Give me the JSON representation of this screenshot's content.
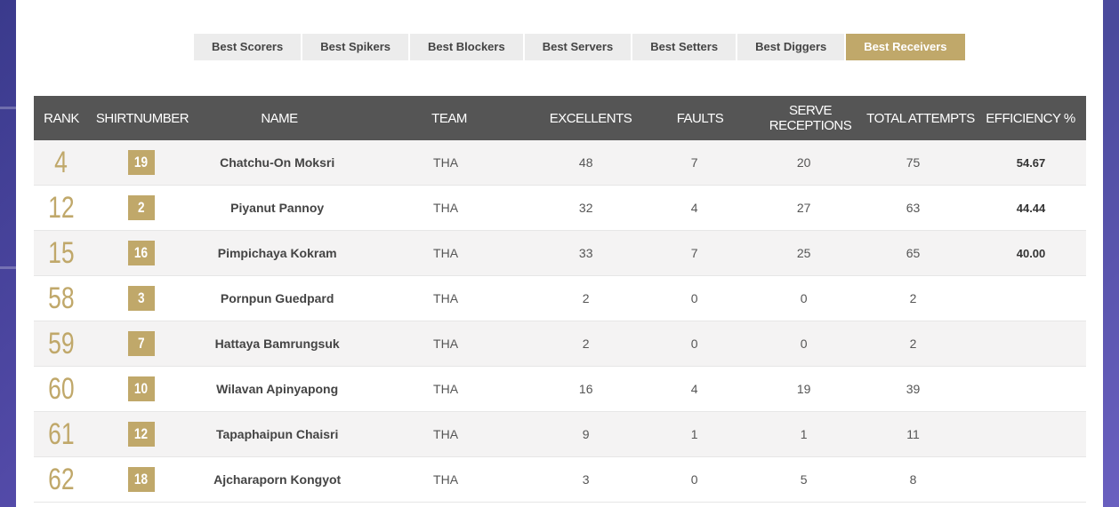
{
  "tabs": [
    {
      "label": "Best Scorers",
      "active": false
    },
    {
      "label": "Best Spikers",
      "active": false
    },
    {
      "label": "Best Blockers",
      "active": false
    },
    {
      "label": "Best Servers",
      "active": false
    },
    {
      "label": "Best Setters",
      "active": false
    },
    {
      "label": "Best Diggers",
      "active": false
    },
    {
      "label": "Best Receivers",
      "active": true
    }
  ],
  "table": {
    "headers": {
      "rank": "RANK",
      "shirt": "SHIRTNUMBER",
      "name": "NAME",
      "team": "TEAM",
      "excellents": "EXCELLENTS",
      "faults": "FAULTS",
      "serve_receptions": "SERVE RECEPTIONS",
      "total_attempts": "TOTAL ATTEMPTS",
      "efficiency": "EFFICIENCY %"
    },
    "rows": [
      {
        "rank": "4",
        "shirt": "19",
        "name": "Chatchu-On Moksri",
        "team": "THA",
        "excellents": "48",
        "faults": "7",
        "serve_receptions": "20",
        "total_attempts": "75",
        "efficiency": "54.67"
      },
      {
        "rank": "12",
        "shirt": "2",
        "name": "Piyanut Pannoy",
        "team": "THA",
        "excellents": "32",
        "faults": "4",
        "serve_receptions": "27",
        "total_attempts": "63",
        "efficiency": "44.44"
      },
      {
        "rank": "15",
        "shirt": "16",
        "name": "Pimpichaya Kokram",
        "team": "THA",
        "excellents": "33",
        "faults": "7",
        "serve_receptions": "25",
        "total_attempts": "65",
        "efficiency": "40.00"
      },
      {
        "rank": "58",
        "shirt": "3",
        "name": "Pornpun Guedpard",
        "team": "THA",
        "excellents": "2",
        "faults": "0",
        "serve_receptions": "0",
        "total_attempts": "2",
        "efficiency": ""
      },
      {
        "rank": "59",
        "shirt": "7",
        "name": "Hattaya Bamrungsuk",
        "team": "THA",
        "excellents": "2",
        "faults": "0",
        "serve_receptions": "0",
        "total_attempts": "2",
        "efficiency": ""
      },
      {
        "rank": "60",
        "shirt": "10",
        "name": "Wilavan Apinyapong",
        "team": "THA",
        "excellents": "16",
        "faults": "4",
        "serve_receptions": "19",
        "total_attempts": "39",
        "efficiency": ""
      },
      {
        "rank": "61",
        "shirt": "12",
        "name": "Tapaphaipun Chaisri",
        "team": "THA",
        "excellents": "9",
        "faults": "1",
        "serve_receptions": "1",
        "total_attempts": "11",
        "efficiency": ""
      },
      {
        "rank": "62",
        "shirt": "18",
        "name": "Ajcharaporn Kongyot",
        "team": "THA",
        "excellents": "3",
        "faults": "0",
        "serve_receptions": "5",
        "total_attempts": "8",
        "efficiency": ""
      }
    ]
  },
  "colors": {
    "accent": "#c0a86a",
    "header_bg": "#555555",
    "tab_bg": "#ececec"
  }
}
